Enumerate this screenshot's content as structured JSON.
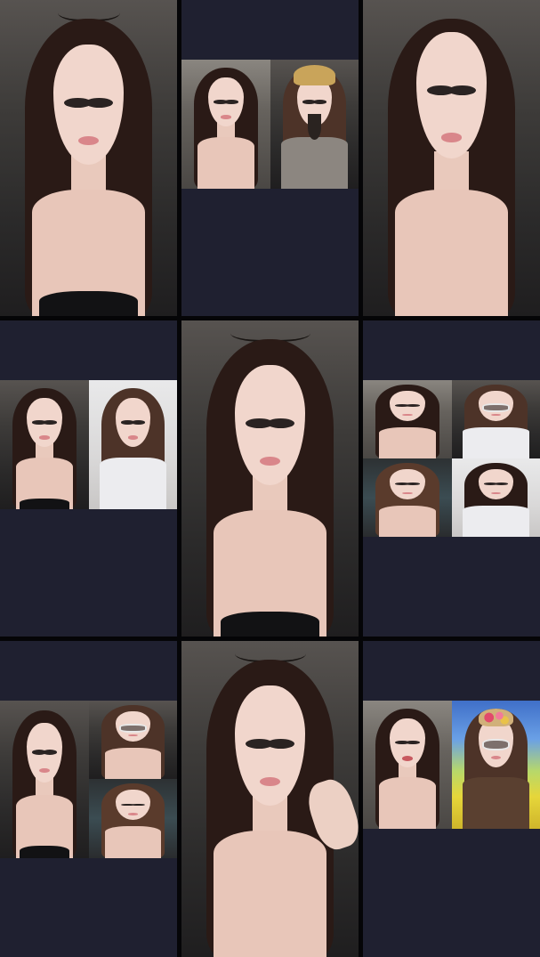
{
  "screen": {
    "title": "",
    "background": "#1f2030"
  },
  "tiles": [
    {
      "id": "tile-1",
      "participants": 1
    },
    {
      "id": "tile-2",
      "participants": 2
    },
    {
      "id": "tile-3",
      "participants": 1
    },
    {
      "id": "tile-4",
      "participants": 2
    },
    {
      "id": "tile-5",
      "participants": 1
    },
    {
      "id": "tile-6",
      "participants": 4
    },
    {
      "id": "tile-7",
      "participants": 3
    },
    {
      "id": "tile-8",
      "participants": 1
    },
    {
      "id": "tile-9",
      "participants": 2
    }
  ],
  "colors": {
    "panel": "#1f2030",
    "gutter": "#050507",
    "hair_dark": "#2a1a16",
    "skin": "#f1d6cc"
  }
}
